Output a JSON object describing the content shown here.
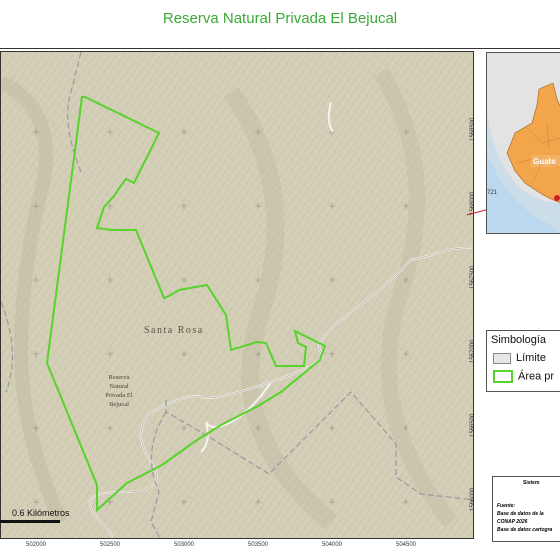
{
  "title": "Reserva Natural Privada El Bejucal",
  "map": {
    "easting_labels": [
      "502000",
      "502500",
      "503000",
      "503500",
      "504000",
      "504500"
    ],
    "northing_labels": [
      "1568500",
      "1568000",
      "1567500",
      "1567000",
      "1566500",
      "1566000"
    ],
    "place_label": "Santa Rosa",
    "reserve_label_lines": [
      "Reserva",
      "Natural",
      "Privada El",
      "Bejucal"
    ],
    "scale_label": "0.6 Kilómetros",
    "colors": {
      "terrain": "#d3ceb6",
      "reserve_boundary": "#57d32c",
      "admin_boundary": "#9a9aa2",
      "road": "#eeeeee"
    }
  },
  "inset": {
    "country_label": "Guate",
    "marker_label": "721",
    "colors": {
      "ocean": "#bcd8ee",
      "highlight": "#f2a54a",
      "callout": "#d0202a"
    }
  },
  "legend": {
    "title": "Simbología",
    "items": [
      {
        "label": "Límite",
        "swatch": "limit"
      },
      {
        "label": "Área pr",
        "swatch": "area"
      }
    ]
  },
  "info": {
    "title": "Sistem",
    "lines": [
      "Fuente:",
      "Base de datos de la",
      "CONAP 2026",
      "Base de datos cartogra"
    ]
  }
}
